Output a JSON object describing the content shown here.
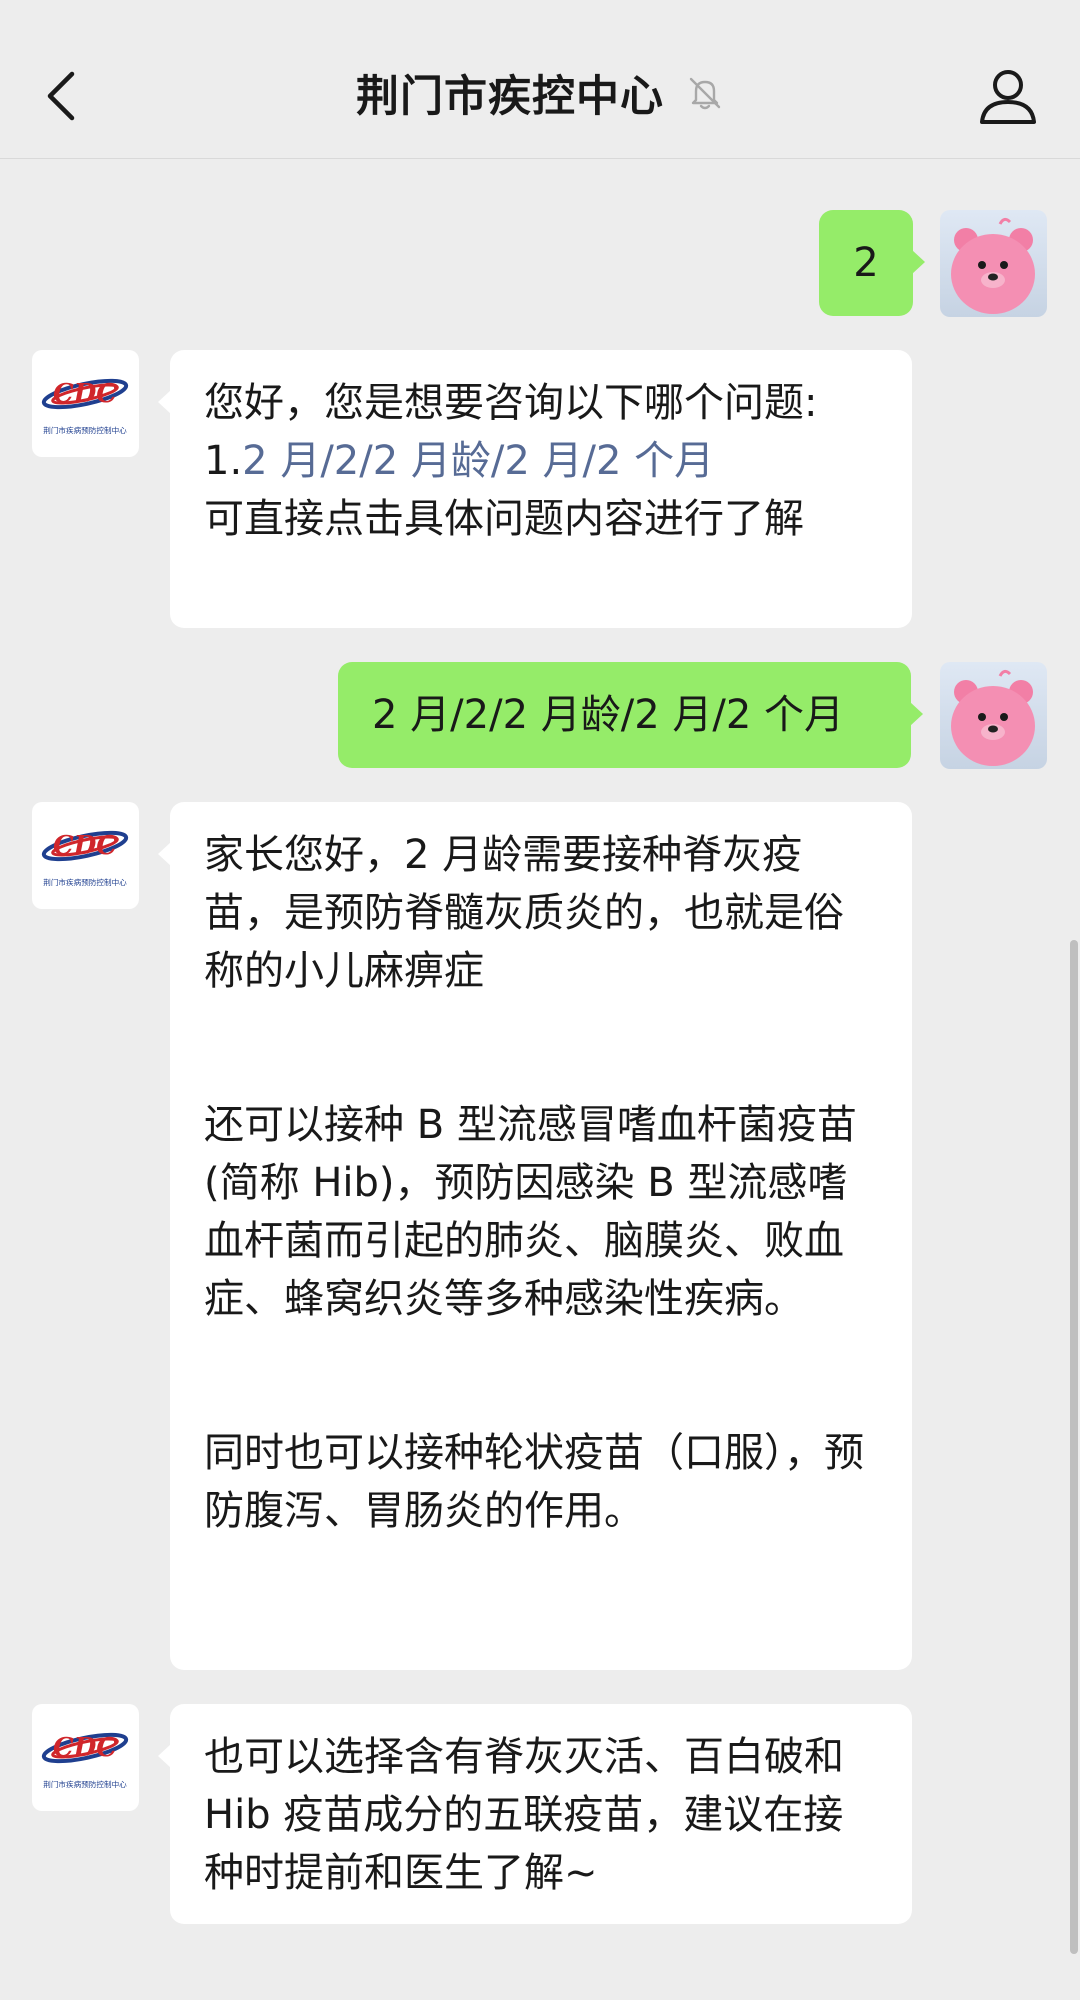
{
  "header": {
    "title": "荆门市疾控中心",
    "back_icon": "chevron-left-icon",
    "mute_icon": "bell-off-icon",
    "profile_icon": "person-icon"
  },
  "cdc_avatar": {
    "logo_text": "CDC",
    "caption": "荆门市疾病预防控制中心"
  },
  "messages": [
    {
      "from": "me",
      "text": "2"
    },
    {
      "from": "cdc",
      "greeting": "您好，您是想要咨询以下哪个问题:",
      "option_prefix": "1.",
      "option_link": "2 月/2/2 月龄/2 月/2 个月",
      "footer": "可直接点击具体问题内容进行了解"
    },
    {
      "from": "me",
      "text": "2 月/2/2 月龄/2 月/2 个月"
    },
    {
      "from": "cdc",
      "paragraphs": [
        "家长您好，2 月龄需要接种脊灰疫苗，是预防脊髓灰质炎的，也就是俗称的小儿麻痹症",
        "还可以接种 B 型流感冒嗜血杆菌疫苗(简称 Hib)，预防因感染 B 型流感嗜血杆菌而引起的肺炎、脑膜炎、败血症、蜂窝织炎等多种感染性疾病。",
        "同时也可以接种轮状疫苗（口服），预防腹泻、胃肠炎的作用。"
      ]
    },
    {
      "from": "cdc",
      "text": "也可以选择含有脊灰灭活、百白破和 Hib 疫苗成分的五联疫苗，建议在接种时提前和医生了解~"
    }
  ],
  "colors": {
    "background": "#ededed",
    "outgoing_bubble": "#95ec69",
    "incoming_bubble": "#ffffff",
    "link": "#576b95",
    "cdc_logo_red": "#d0262b",
    "cdc_logo_blue": "#1f3f8f"
  }
}
